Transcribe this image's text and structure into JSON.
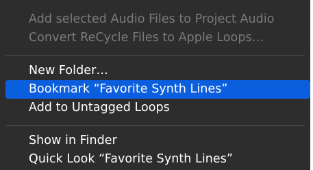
{
  "menu": {
    "items": [
      {
        "label": "Add selected Audio Files to Project Audio",
        "state": "disabled"
      },
      {
        "label": "Convert ReCycle Files to Apple Loops…",
        "state": "disabled"
      },
      {
        "label": "New Folder…",
        "state": "normal"
      },
      {
        "label": "Bookmark “Favorite Synth Lines”",
        "state": "selected"
      },
      {
        "label": "Add to Untagged Loops",
        "state": "normal"
      },
      {
        "label": "Show in Finder",
        "state": "normal"
      },
      {
        "label": "Quick Look “Favorite Synth Lines”",
        "state": "normal"
      }
    ]
  },
  "colors": {
    "menu_background": "#2d2d2d",
    "selection": "#0b5fde",
    "disabled_text": "#7b7b7b",
    "text": "#ffffff"
  }
}
